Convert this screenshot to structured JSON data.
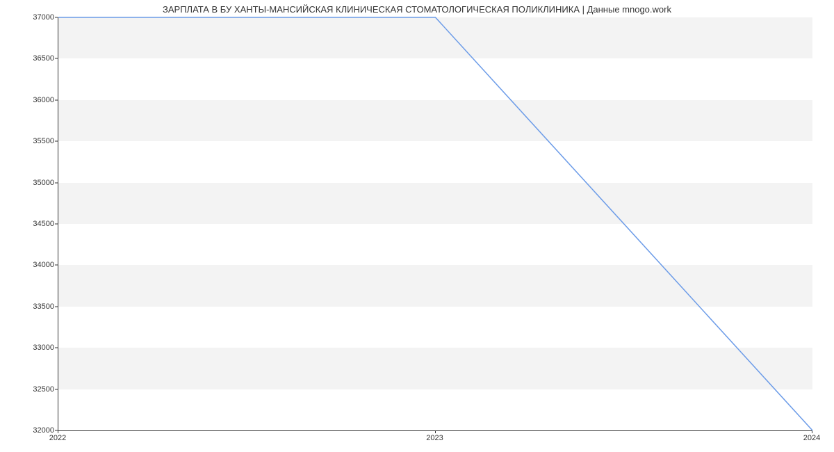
{
  "chart_data": {
    "type": "line",
    "title": "ЗАРПЛАТА В БУ ХАНТЫ-МАНСИЙСКАЯ КЛИНИЧЕСКАЯ СТОМАТОЛОГИЧЕСКАЯ ПОЛИКЛИНИКА | Данные mnogo.work",
    "x": [
      2022,
      2023,
      2024
    ],
    "values": [
      37000,
      37000,
      32000
    ],
    "xlabel": "",
    "ylabel": "",
    "ylim": [
      32000,
      37000
    ],
    "yticks": [
      32000,
      32500,
      33000,
      33500,
      34000,
      34500,
      35000,
      35500,
      36000,
      36500,
      37000
    ],
    "xticks": [
      2022,
      2023,
      2024
    ],
    "line_color": "#6b9be8"
  }
}
